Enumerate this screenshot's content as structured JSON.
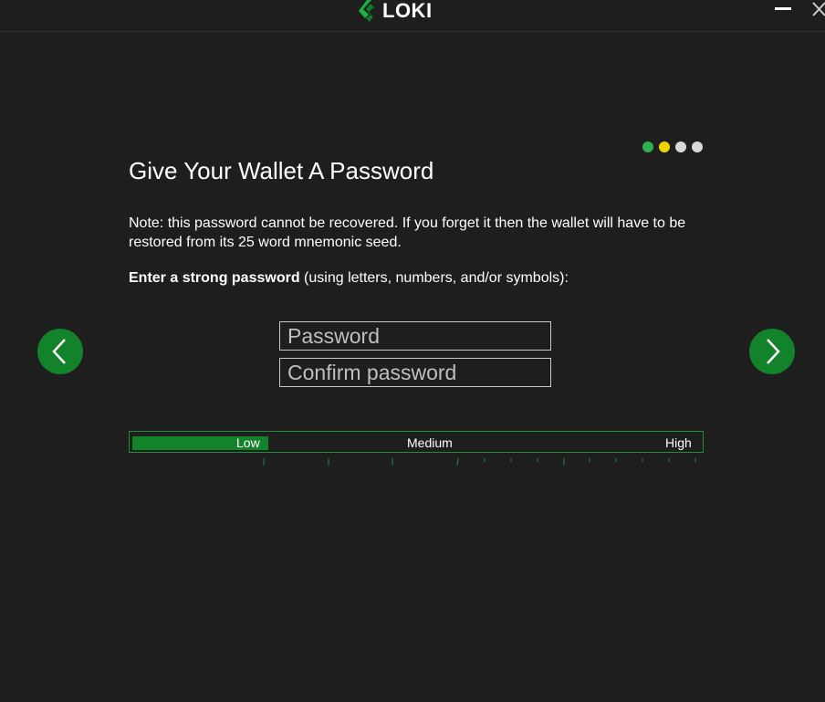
{
  "app": {
    "name": "LOKI",
    "brand_color": "#1bb13f"
  },
  "window_controls": {
    "minimize_icon": "minimize-icon",
    "close_icon": "close-icon"
  },
  "wizard": {
    "title": "Give Your Wallet A Password",
    "step_dots": [
      {
        "state": "done",
        "color": "#2fb14c"
      },
      {
        "state": "current",
        "color": "#f2d400"
      },
      {
        "state": "todo",
        "color": "#d9d9d9"
      },
      {
        "state": "todo",
        "color": "#d9d9d9"
      }
    ],
    "note": "Note: this password cannot be recovered. If you forget it then the wallet will have to be restored from its 25 word mnemonic seed.",
    "instruction_bold": "Enter a strong password",
    "instruction_rest": " (using letters, numbers, and/or symbols):",
    "password": {
      "placeholder": "Password",
      "value": ""
    },
    "confirm_password": {
      "placeholder": "Confirm password",
      "value": ""
    },
    "nav": {
      "prev_icon": "chevron-left-icon",
      "next_icon": "chevron-right-icon"
    }
  },
  "strength_meter": {
    "labels": {
      "low": "Low",
      "medium": "Medium",
      "high": "High"
    },
    "level_fraction": 0.24,
    "color": "#12832a"
  }
}
